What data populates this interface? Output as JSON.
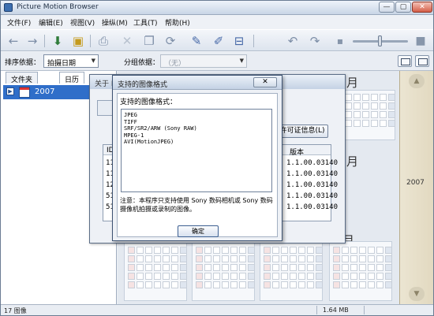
{
  "window": {
    "title": "Picture Motion Browser",
    "min": "—",
    "max": "▢",
    "close": "✕"
  },
  "menu": [
    "文件(F)",
    "编辑(E)",
    "视图(V)",
    "操纵(M)",
    "工具(T)",
    "帮助(H)"
  ],
  "sortbar": {
    "sort_label": "排序依据：",
    "sort_value": "拍摄日期",
    "group_label": "分组依据：",
    "group_value": "（无）"
  },
  "leftpanel": {
    "tabs": [
      "文件夹",
      "日历"
    ],
    "tree_year": "2007"
  },
  "calendar": {
    "month_labels": [
      "月",
      "月",
      "二月"
    ]
  },
  "yearstrip": {
    "year": "2007"
  },
  "status": {
    "count": "17 图像",
    "size": "1.64 MB"
  },
  "about_dialog": {
    "title": "关于 P",
    "license_button": "许可证信息(L)",
    "col_id": "ID",
    "col_version": "版本",
    "ids": [
      "11",
      "11",
      "12",
      "51",
      "51"
    ],
    "versions": [
      "1.1.00.03140",
      "1.1.00.03140",
      "1.1.00.03140",
      "1.1.00.03140",
      "1.1.00.03140"
    ]
  },
  "formats_dialog": {
    "title": "支持的图像格式",
    "close": "✕",
    "heading": "支持的图像格式：",
    "formats": [
      "JPEG",
      "TIFF",
      "SRF/SR2/ARW (Sony RAW)",
      "MPEG-1",
      "AVI(MotionJPEG)"
    ],
    "note": "注意：本程序只支持使用 Sony 数码相机或 Sony 数码摄像机拍摄或录制的图像。",
    "ok_button": "确定"
  }
}
